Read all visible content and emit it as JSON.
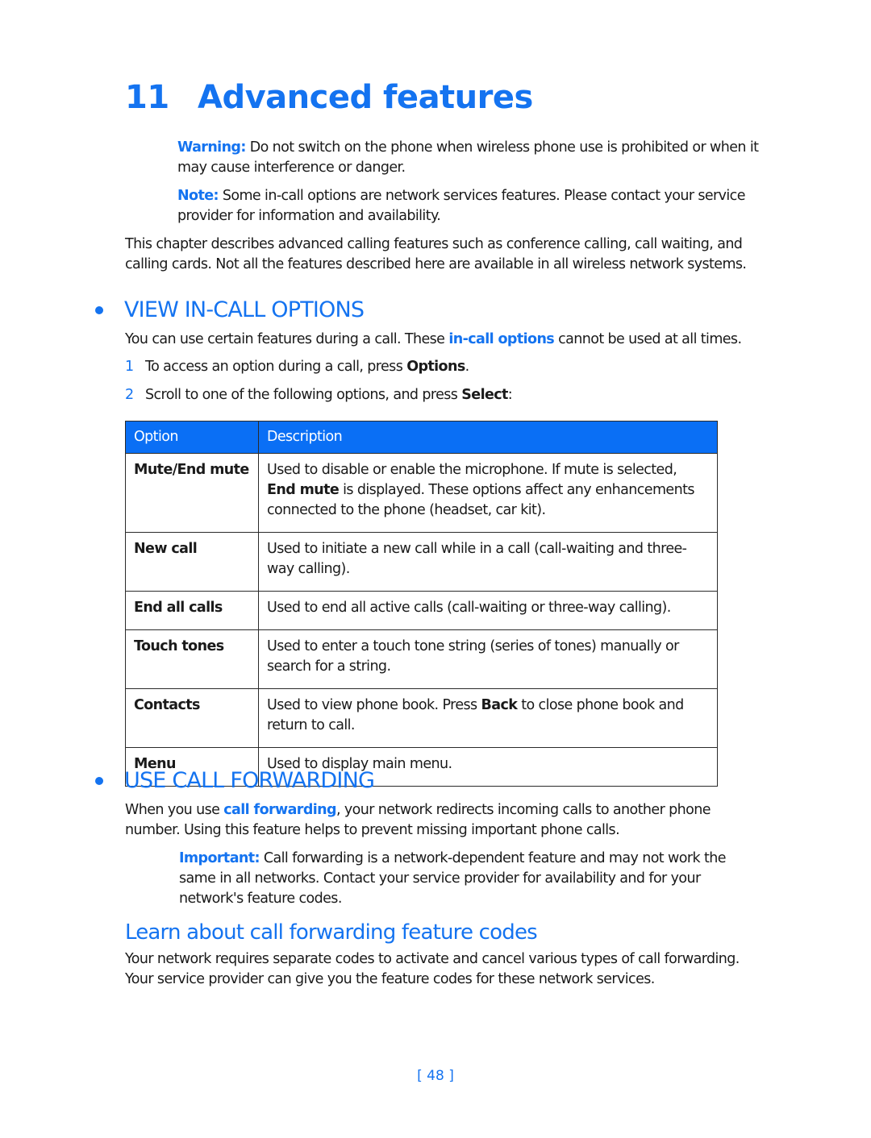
{
  "chapter": {
    "number": "11",
    "title": "Advanced features"
  },
  "notices": {
    "warning": {
      "label": "Warning:",
      "text": " Do not switch on the phone when wireless phone use is prohibited or when it may cause interference or danger."
    },
    "note": {
      "label": "Note:",
      "text": " Some in-call options are network services features. Please contact your service provider for information and availability."
    }
  },
  "intro": "This chapter describes advanced calling features such as conference calling, call waiting, and calling cards. Not all the features described here are available in all wireless network systems.",
  "section_incall": {
    "heading": "VIEW IN-CALL OPTIONS",
    "para_before": "You can use certain features during a call. These ",
    "para_link": "in-call options",
    "para_after": " cannot be used at all times.",
    "steps": [
      {
        "num": "1",
        "before": "To access an option during a call, press ",
        "bold": "Options",
        "after": "."
      },
      {
        "num": "2",
        "before": "Scroll to one of the following options, and press ",
        "bold": "Select",
        "after": ":"
      }
    ],
    "table": {
      "headers": [
        "Option",
        "Description"
      ],
      "rows": [
        {
          "option": "Mute/End mute",
          "desc_before": "Used to disable or enable the microphone. If mute is selected, ",
          "desc_bold": "End mute",
          "desc_after": " is displayed. These options affect any enhancements connected to the phone (headset, car kit)."
        },
        {
          "option": "New call",
          "desc_before": "Used to initiate a new call while in a call (call-waiting and three-way calling).",
          "desc_bold": "",
          "desc_after": ""
        },
        {
          "option": "End all calls",
          "desc_before": "Used to end all active calls (call-waiting or three-way calling).",
          "desc_bold": "",
          "desc_after": ""
        },
        {
          "option": "Touch tones",
          "desc_before": "Used to enter a touch tone string (series of tones) manually or search for a string.",
          "desc_bold": "",
          "desc_after": ""
        },
        {
          "option": "Contacts",
          "desc_before": "Used to view phone book. Press ",
          "desc_bold": "Back",
          "desc_after": " to close phone book and return to call."
        },
        {
          "option": "Menu",
          "desc_before": "Used to display main menu.",
          "desc_bold": "",
          "desc_after": ""
        }
      ]
    }
  },
  "section_forwarding": {
    "heading": "USE CALL FORWARDING",
    "para_before": "When you use ",
    "para_link": "call forwarding",
    "para_after": ", your network redirects incoming calls to another phone number. Using this feature helps to prevent missing important phone calls.",
    "important": {
      "label": "Important:",
      "text": " Call forwarding is a network-dependent feature and may not work the same in all networks. Contact your service provider for availability and for your network's feature codes."
    },
    "subheading": "Learn about call forwarding feature codes",
    "sub_para": "Your network requires separate codes to activate and cancel various types of call forwarding. Your service provider can give you the feature codes for these network services."
  },
  "page_number": "[ 48 ]",
  "colors": {
    "accent": "#1473f0",
    "table_header": "#0a6ff5",
    "text": "#1a1a1a"
  }
}
